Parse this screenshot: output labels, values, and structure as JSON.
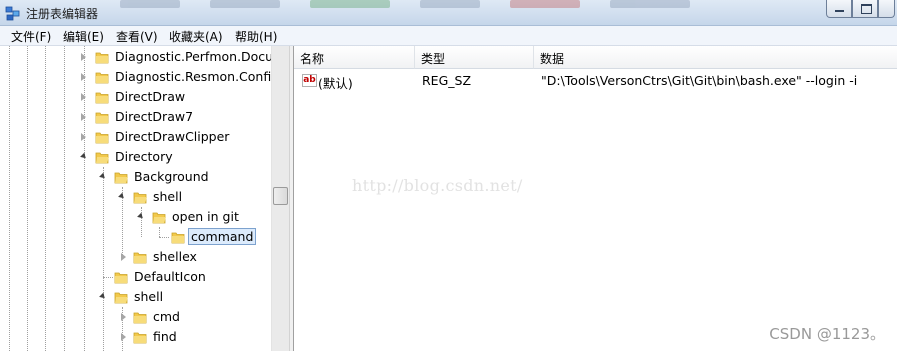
{
  "window": {
    "title": "注册表编辑器"
  },
  "menu": [
    "文件(F)",
    "编辑(E)",
    "查看(V)",
    "收藏夹(A)",
    "帮助(H)"
  ],
  "tree": {
    "nodes": [
      {
        "label": "Diagnostic.Perfmon.Docum",
        "state": "collapsed"
      },
      {
        "label": "Diagnostic.Resmon.Config",
        "state": "collapsed"
      },
      {
        "label": "DirectDraw",
        "state": "collapsed"
      },
      {
        "label": "DirectDraw7",
        "state": "collapsed"
      },
      {
        "label": "DirectDrawClipper",
        "state": "collapsed"
      },
      {
        "label": "Directory",
        "state": "expanded"
      },
      {
        "label": "Background",
        "state": "expanded"
      },
      {
        "label": "shell",
        "state": "expanded"
      },
      {
        "label": "open in git",
        "state": "expanded"
      },
      {
        "label": "command",
        "state": "selected"
      },
      {
        "label": "shellex",
        "state": "collapsed"
      },
      {
        "label": "DefaultIcon",
        "state": "none"
      },
      {
        "label": "shell",
        "state": "expanded"
      },
      {
        "label": "cmd",
        "state": "collapsed"
      },
      {
        "label": "find",
        "state": "collapsed"
      }
    ]
  },
  "list": {
    "columns": {
      "name": "名称",
      "type": "类型",
      "data": "数据"
    },
    "rows": [
      {
        "name": "(默认)",
        "type": "REG_SZ",
        "data": "\"D:\\Tools\\VersonCtrs\\Git\\Git\\bin\\bash.exe\" --login -i"
      }
    ]
  },
  "value_icon_text": "ab",
  "watermark": "http://blog.csdn.net/",
  "credit": "CSDN @1123。",
  "colors": {
    "folder": "#f2c94c",
    "selection": "#dcebfc",
    "titlebar": "#c5d6ea"
  }
}
